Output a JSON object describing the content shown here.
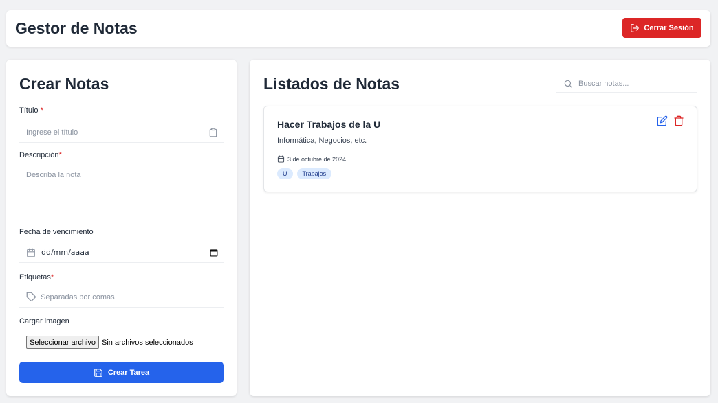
{
  "header": {
    "title": "Gestor de Notas",
    "logout_label": "Cerrar Sesión"
  },
  "create_form": {
    "title": "Crear Notas",
    "title_label": "Título",
    "title_required": "*",
    "title_placeholder": "Ingrese el título",
    "description_label": "Descripción",
    "description_required": "*",
    "description_placeholder": "Describa la nota",
    "due_date_label": "Fecha de vencimiento",
    "due_date_value": "dd/mm/aaaa",
    "tags_label": "Etiquetas",
    "tags_required": "*",
    "tags_placeholder": "Separadas por comas",
    "image_label": "Cargar imagen",
    "file_button_label": "Seleccionar archivo",
    "file_status": "Sin archivos seleccionados",
    "submit_label": "Crear Tarea"
  },
  "notes_list": {
    "title": "Listados de Notas",
    "search_placeholder": "Buscar notas...",
    "notes": [
      {
        "title": "Hacer Trabajos de la U",
        "description": "Informática, Negocios, etc.",
        "date": "3 de octubre de 2024",
        "tags": [
          "U",
          "Trabajos"
        ]
      }
    ]
  },
  "colors": {
    "primary": "#2563eb",
    "danger": "#dc2626",
    "tag_bg": "#dbeafe",
    "background": "#f1f2f4"
  },
  "icons": {
    "logout": "logout-icon",
    "clipboard": "clipboard-icon",
    "calendar": "calendar-icon",
    "tag": "tag-icon",
    "save": "save-icon",
    "search": "search-icon",
    "edit": "edit-icon",
    "delete": "trash-icon"
  }
}
